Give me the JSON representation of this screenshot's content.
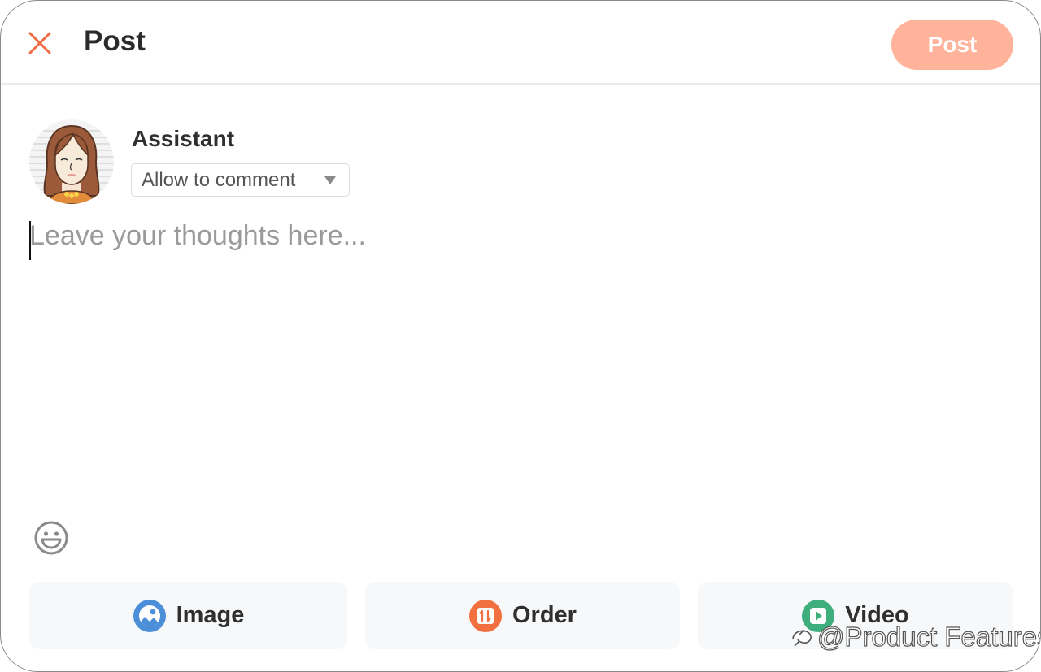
{
  "header": {
    "close_icon": "close-icon",
    "title": "Post",
    "post_button_label": "Post",
    "post_button_color": "#ffb39a",
    "accent_color": "#f06a43"
  },
  "author": {
    "name": "Assistant",
    "avatar": "avatar-woman-brown-hair",
    "comment_permission": {
      "selected": "Allow to comment",
      "icon": "caret-down-icon"
    }
  },
  "composer": {
    "value": "",
    "placeholder": "Leave your thoughts here...",
    "emoji_icon": "smiley-icon"
  },
  "attachments": [
    {
      "label": "Image",
      "icon": "image-icon",
      "color": "#4a8fd8"
    },
    {
      "label": "Order",
      "icon": "sort-order-icon",
      "color": "#f2703f"
    },
    {
      "label": "Video",
      "icon": "video-play-icon",
      "color": "#3fae7d"
    }
  ],
  "watermark": {
    "text": "@Product Features",
    "icon": "weibo-logo-icon"
  }
}
